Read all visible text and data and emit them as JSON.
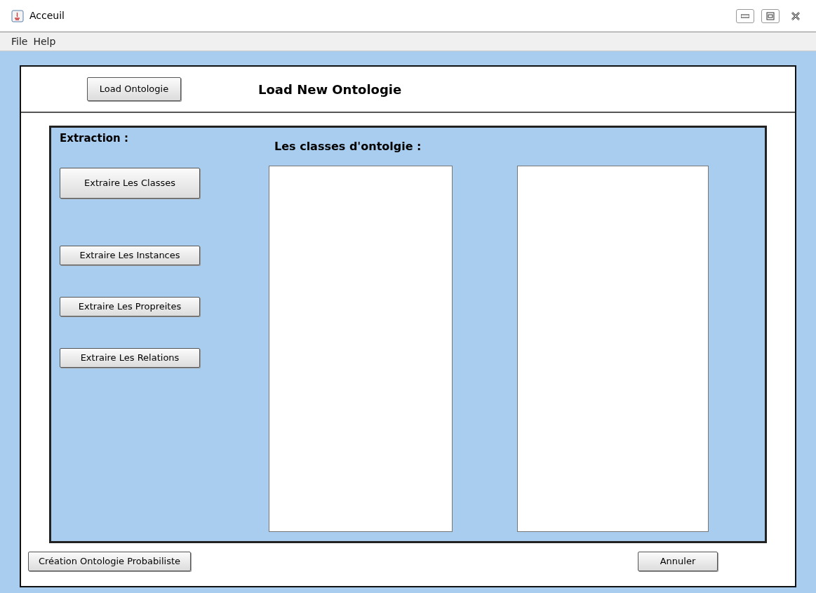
{
  "window": {
    "title": "Acceuil"
  },
  "menu": [
    "File",
    "Help"
  ],
  "header": {
    "button": "Load Ontologie",
    "title": "Load New Ontologie"
  },
  "extraction": {
    "label": "Extraction :",
    "buttons": [
      {
        "label": "Extraire Les Classes",
        "kind": "tall"
      },
      {
        "label": "Extraire Les Instances",
        "kind": "normal"
      },
      {
        "label": "Extraire Les Propreites",
        "kind": "normal"
      },
      {
        "label": "Extraire Les Relations",
        "kind": "normal"
      }
    ]
  },
  "classes": {
    "label": "Les classes d'ontolgie :"
  },
  "footer": {
    "buttons": [
      "Création Ontologie Probabiliste",
      "Annuler"
    ]
  }
}
